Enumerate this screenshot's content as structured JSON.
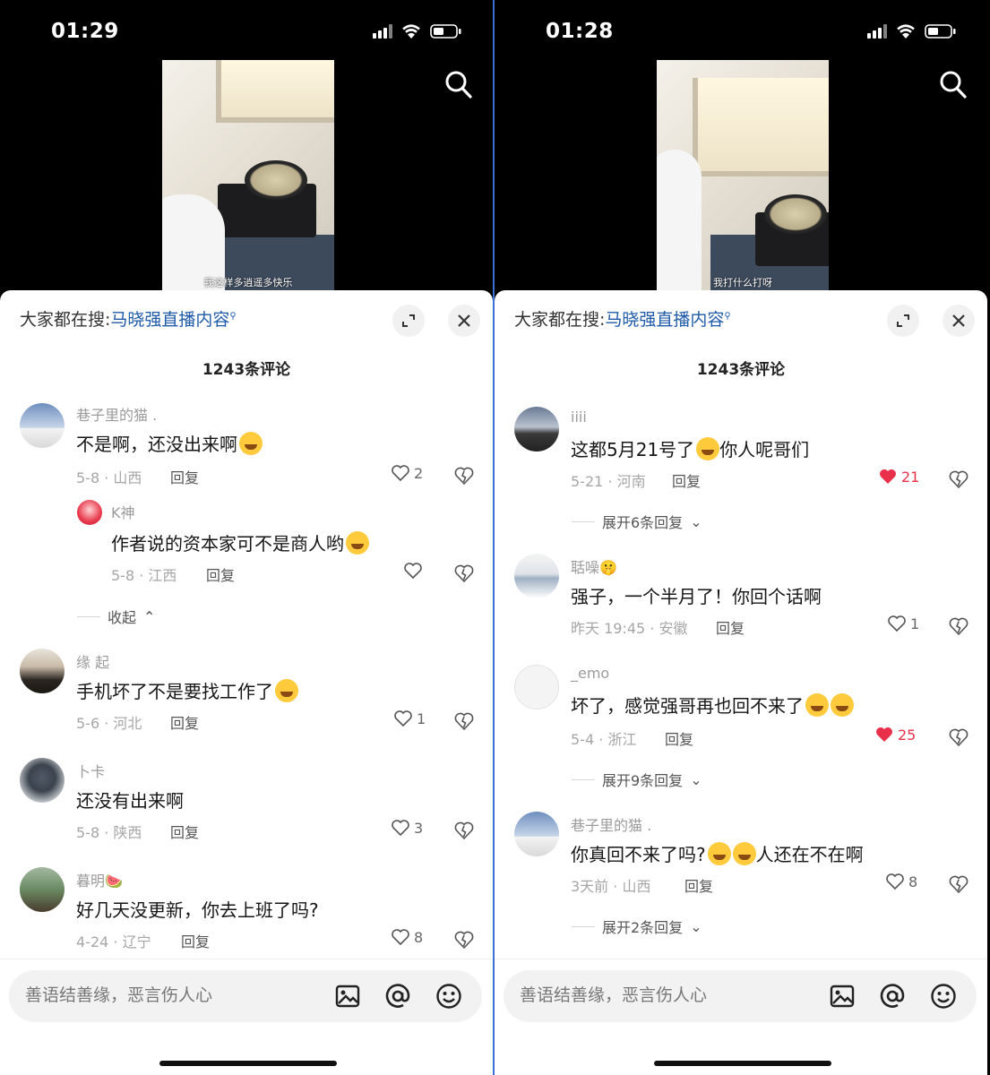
{
  "screens": [
    {
      "status_time": "01:29",
      "video_caption": "我这样多逍遥多快乐",
      "hot_search_prefix": "大家都在搜:",
      "hot_search_keyword": "马晓强直播内容",
      "comment_count": "1243条评论",
      "input_placeholder": "善语结善缘，恶言伤人心",
      "comments": [
        {
          "user": "巷子里的猫 .",
          "text": "不是啊，还没出来啊",
          "emoji": "😂",
          "meta": "5-8 · 山西",
          "reply": "回复",
          "likes": "2"
        },
        {
          "user": "K神",
          "text": "作者说的资本家可不是商人哟",
          "emoji": "😅",
          "meta": "5-8 · 江西",
          "reply": "回复",
          "likes": "",
          "sub": true
        },
        {
          "collapse": "收起"
        },
        {
          "user": "缘 起",
          "text": "手机坏了不是要找工作了",
          "emoji": "😂",
          "meta": "5-6 · 河北",
          "reply": "回复",
          "likes": "1"
        },
        {
          "user": "卜卡",
          "text": "还没有出来啊",
          "emoji": "",
          "meta": "5-8 · 陕西",
          "reply": "回复",
          "likes": "3"
        },
        {
          "user": "暮明🍉",
          "text": "好几天没更新，你去上班了吗?",
          "emoji": "",
          "meta": "4-24 · 辽宁",
          "reply": "回复",
          "likes": "8"
        }
      ]
    },
    {
      "status_time": "01:28",
      "video_caption": "我打什么打呀",
      "hot_search_prefix": "大家都在搜:",
      "hot_search_keyword": "马晓强直播内容",
      "comment_count": "1243条评论",
      "input_placeholder": "善语结善缘，恶言伤人心",
      "comments": [
        {
          "user": "iiii",
          "text": "这都5月21号了",
          "text2": "你人呢哥们",
          "emoji": "😰",
          "meta": "5-21 · 河南",
          "reply": "回复",
          "likes": "21",
          "liked": true
        },
        {
          "expand": "展开6条回复"
        },
        {
          "user": "聒噪🤫",
          "text": "强子，一个半月了！你回个话啊",
          "emoji": "",
          "meta": "昨天 19:45 · 安徽",
          "reply": "回复",
          "likes": "1"
        },
        {
          "user": "_emo",
          "text": "坏了，感觉强哥再也回不来了",
          "emoji": "😅😭",
          "meta": "5-4 · 浙江",
          "reply": "回复",
          "likes": "25",
          "liked": true
        },
        {
          "expand": "展开9条回复"
        },
        {
          "user": "巷子里的猫 .",
          "text": "你真回不来了吗?",
          "text2": "人还在不在啊",
          "emoji": "😭😭",
          "meta": "3天前 · 山西",
          "reply": "回复",
          "likes": "8"
        },
        {
          "expand": "展开2条回复"
        }
      ]
    }
  ],
  "icons": [
    "search-icon",
    "expand-icon",
    "close-icon",
    "heart-icon",
    "dislike-heart-icon",
    "image-icon",
    "at-icon",
    "emoji-icon",
    "wifi-icon",
    "battery-icon",
    "signal-icon"
  ],
  "colors": {
    "keyword": "#1f5aa8",
    "liked": "#e8304b"
  }
}
